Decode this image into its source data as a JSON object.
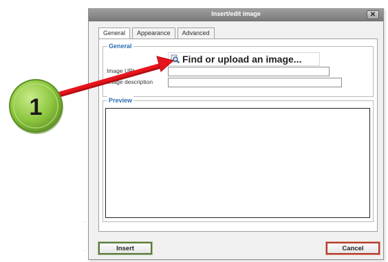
{
  "dialog": {
    "title": "Insert/edit image",
    "close_glyph": "✕"
  },
  "tabs": [
    {
      "label": "General",
      "active": true
    },
    {
      "label": "Appearance",
      "active": false
    },
    {
      "label": "Advanced",
      "active": false
    }
  ],
  "general": {
    "legend": "General",
    "find_button_label": "Find or upload an image...",
    "find_button_icon": "search-icon",
    "image_url_label": "Image URL",
    "image_url_value": "",
    "image_description_label": "Image description",
    "image_description_value": ""
  },
  "preview": {
    "legend": "Preview"
  },
  "buttons": {
    "insert_label": "Insert",
    "cancel_label": "Cancel"
  },
  "annotation": {
    "step_number": "1",
    "marker_color": "#8dc63f",
    "arrow_color": "#e8141c"
  }
}
